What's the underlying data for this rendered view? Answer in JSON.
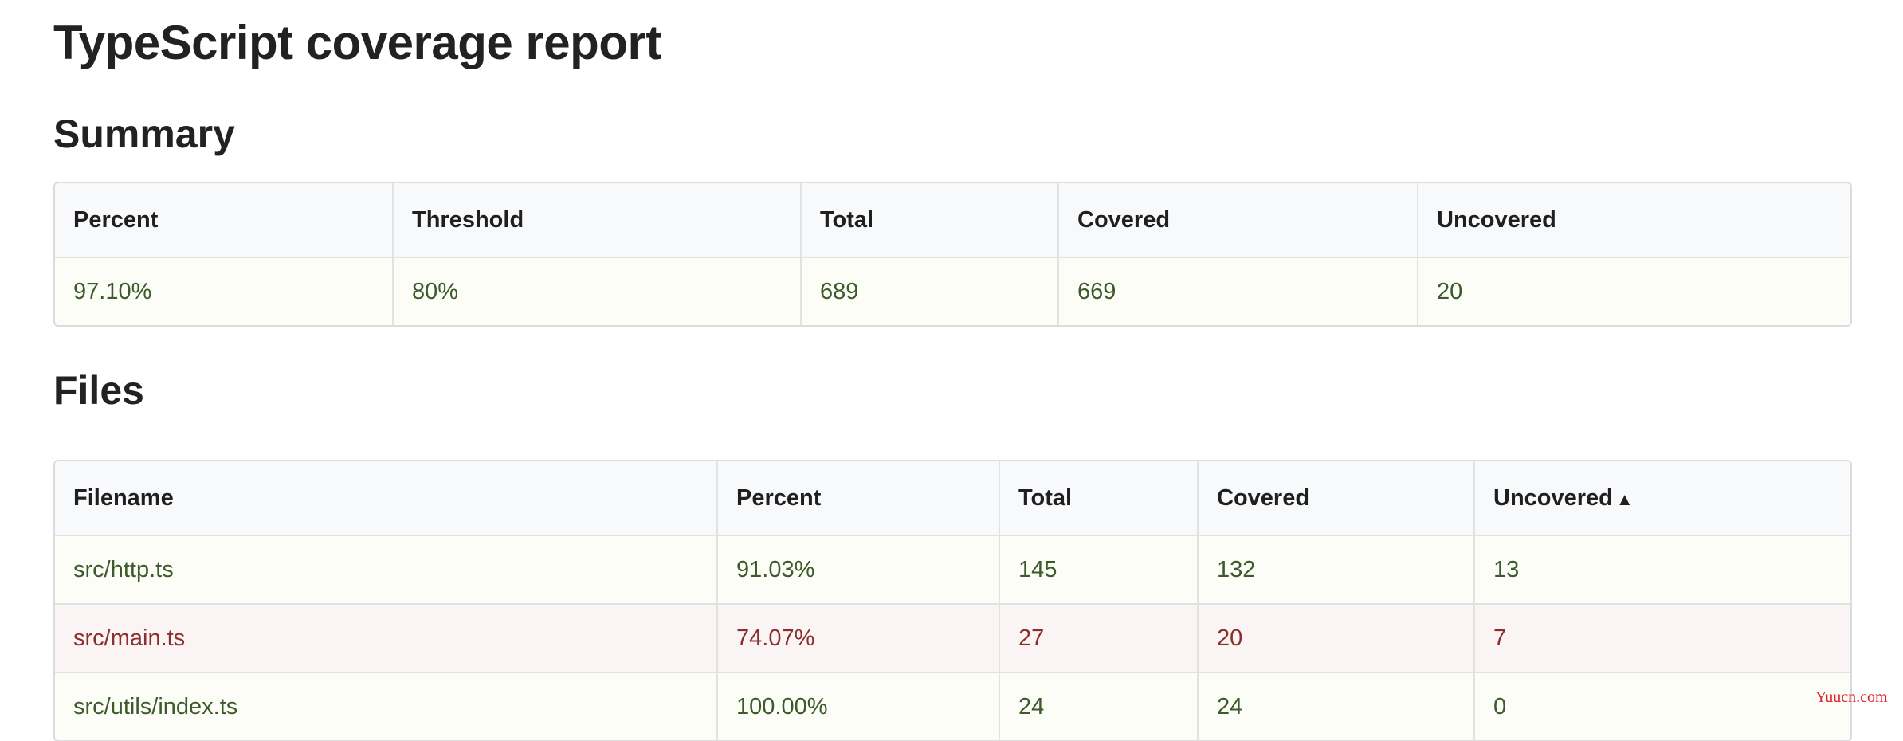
{
  "page": {
    "title": "TypeScript coverage report"
  },
  "summary": {
    "heading": "Summary",
    "columns": [
      "Percent",
      "Threshold",
      "Total",
      "Covered",
      "Uncovered"
    ],
    "row": {
      "percent": "97.10%",
      "threshold": "80%",
      "total": "689",
      "covered": "669",
      "uncovered": "20"
    }
  },
  "files": {
    "heading": "Files",
    "columns": [
      "Filename",
      "Percent",
      "Total",
      "Covered",
      "Uncovered"
    ],
    "sort_indicator": "▲",
    "rows": [
      {
        "filename": "src/http.ts",
        "percent": "91.03%",
        "total": "145",
        "covered": "132",
        "uncovered": "13",
        "status": "ok"
      },
      {
        "filename": "src/main.ts",
        "percent": "74.07%",
        "total": "27",
        "covered": "20",
        "uncovered": "7",
        "status": "bad"
      },
      {
        "filename": "src/utils/index.ts",
        "percent": "100.00%",
        "total": "24",
        "covered": "24",
        "uncovered": "0",
        "status": "ok"
      }
    ]
  },
  "colors": {
    "ok_text": "#3c5a2a",
    "ok_bg": "#fcfdf6",
    "bad_text": "#8b2e2e",
    "bad_bg": "#fbf4f4",
    "header_bg": "#f8f9fb"
  },
  "watermark": "Yuucn.com"
}
